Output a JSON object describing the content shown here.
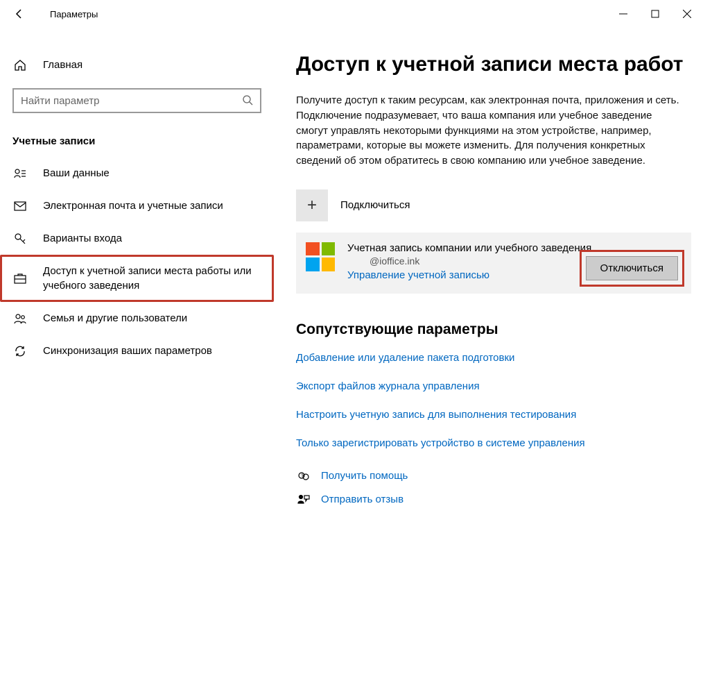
{
  "titlebar": {
    "title": "Параметры"
  },
  "sidebar": {
    "home_label": "Главная",
    "search_placeholder": "Найти параметр",
    "section_header": "Учетные записи",
    "items": [
      {
        "label": "Ваши данные"
      },
      {
        "label": "Электронная почта и учетные записи"
      },
      {
        "label": "Варианты входа"
      },
      {
        "label": "Доступ к учетной записи места работы или учебного заведения"
      },
      {
        "label": "Семья и другие пользователи"
      },
      {
        "label": "Синхронизация ваших параметров"
      }
    ]
  },
  "content": {
    "heading": "Доступ к учетной записи места работ",
    "description": "Получите доступ к таким ресурсам, как электронная почта, приложения и сеть. Подключение подразумевает, что ваша компания или учебное заведение смогут управлять некоторыми функциями на этом устройстве, например, параметрами, которые вы можете изменить. Для получения конкретных сведений об этом обратитесь в свою компанию или учебное заведение.",
    "connect_label": "Подключиться",
    "account": {
      "title": "Учетная запись компании или учебного заведения",
      "email": "@ioffice.ink",
      "manage_link": "Управление учетной записью",
      "disconnect_label": "Отключиться"
    },
    "related": {
      "heading": "Сопутствующие параметры",
      "links": [
        "Добавление или удаление пакета подготовки",
        "Экспорт файлов журнала управления",
        "Настроить учетную запись для выполнения тестирования",
        "Только зарегистрировать устройство в системе управления"
      ]
    },
    "footer": {
      "help": "Получить помощь",
      "feedback": "Отправить отзыв"
    }
  }
}
